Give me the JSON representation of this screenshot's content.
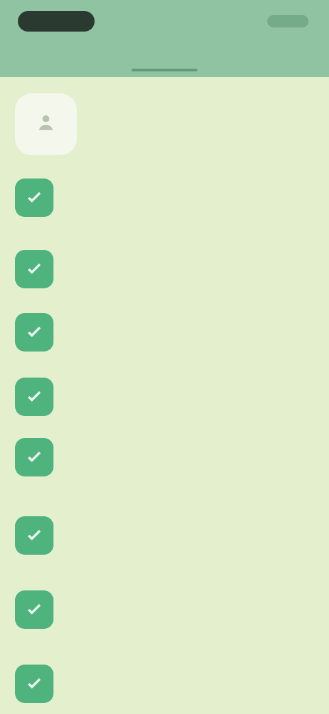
{
  "header": {
    "title": "",
    "status_time": "",
    "status_right": ""
  },
  "profile": {
    "name": ""
  },
  "list": [
    {
      "text": "",
      "icon": "check-icon"
    },
    {
      "text": "",
      "icon": "check-icon"
    },
    {
      "text": "",
      "icon": "check-icon"
    },
    {
      "text": "",
      "icon": "check-icon"
    },
    {
      "text": "",
      "icon": "check-icon"
    },
    {
      "text": "",
      "icon": "check-icon"
    },
    {
      "text": "",
      "icon": "check-icon"
    },
    {
      "text": "",
      "icon": "check-icon"
    }
  ],
  "colors": {
    "header_bg": "#8fc3a2",
    "page_bg": "#e4efcd",
    "item_icon": "#4fb37d",
    "avatar_bg": "#f4f7ec"
  }
}
